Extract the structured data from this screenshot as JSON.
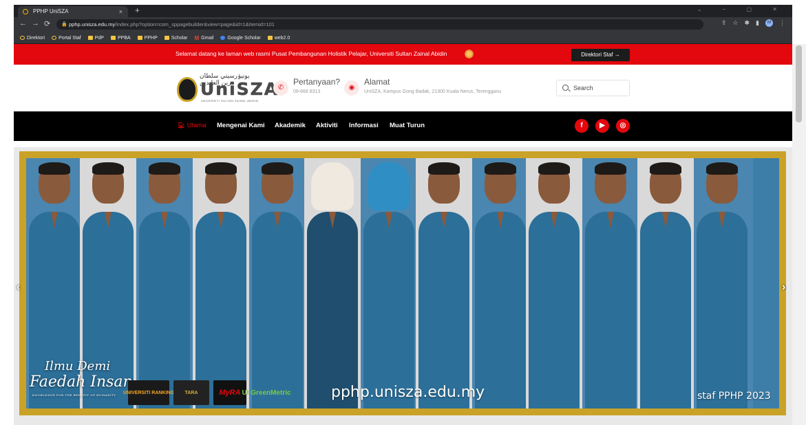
{
  "browser": {
    "tab_title": "PPHP UniSZA",
    "tab_close": "×",
    "new_tab": "+",
    "window_controls": "⌄ − ▢ ✕",
    "url_host": "pphp.unisza.edu.my",
    "url_path": "/index.php?option=com_sppagebuilder&view=page&id=1&Itemid=101",
    "profile_initial": "M",
    "bookmarks": [
      "Direktori",
      "Portal Staf",
      "PdP",
      "PPBA",
      "PPHP",
      "Scholar",
      "Gmail",
      "Google Scholar",
      "web2.0"
    ]
  },
  "announce": {
    "text": "Selamat datang ke laman web rasmi Pusat Pembangunan Holistik Pelajar, Universiti Sultan Zainal Abidin",
    "button": "Direktori Staf →"
  },
  "header": {
    "logo_arabic": "يونيۏرسيتي سلطان زين العابدين",
    "logo_word": "UniSZA",
    "logo_tagline": "UNIVERSITI SULTAN ZAINAL ABIDIN",
    "phone_title": "Pertanyaan?",
    "phone_value": "09-668 8313",
    "address_title": "Alamat",
    "address_value": "UniSZA, Kampus Gong Badak, 21300 Kuala Nerus, Terengganu",
    "search_placeholder": "Search"
  },
  "menu": {
    "items": [
      {
        "label": "Utama",
        "active": true
      },
      {
        "label": "Mengenai Kami",
        "active": false
      },
      {
        "label": "Akademik",
        "active": false
      },
      {
        "label": "Aktiviti",
        "active": false
      },
      {
        "label": "Informasi",
        "active": false
      },
      {
        "label": "Muat Turun",
        "active": false
      }
    ],
    "social": [
      "facebook-icon",
      "youtube-icon",
      "github-icon"
    ]
  },
  "hero": {
    "url_text": "pphp.unisza.edu.my",
    "staf_text": "staf PPHP 2023",
    "motto_line1": "Ilmu Demi",
    "motto_line2": "Faedah Insan",
    "motto_line3": "KNOWLEDGE FOR THE BENEFIT OF HUMANITY",
    "badges": [
      "UNIVERSITI RANKING",
      "TARA",
      "MyRA",
      "UI GreenMetric"
    ],
    "prev_arrow": "‹",
    "next_arrow": "›"
  },
  "colors": {
    "brand_red": "#e3070e",
    "menu_bg": "#000000",
    "frame_gold": "#c9a227",
    "chrome_dark": "#202124"
  }
}
